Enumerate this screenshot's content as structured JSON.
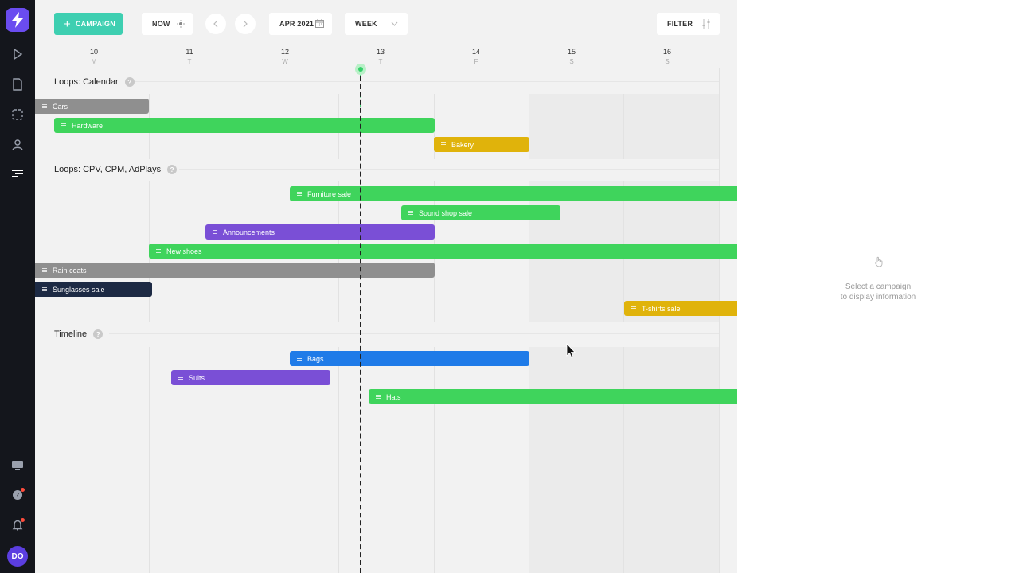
{
  "toolbar": {
    "campaign_label": "CAMPAIGN",
    "now_label": "NOW",
    "date_label": "APR 2021",
    "view_label": "WEEK",
    "filter_label": "FILTER"
  },
  "days": [
    {
      "num": "10",
      "dow": "M"
    },
    {
      "num": "11",
      "dow": "T"
    },
    {
      "num": "12",
      "dow": "W"
    },
    {
      "num": "13",
      "dow": "T"
    },
    {
      "num": "14",
      "dow": "F"
    },
    {
      "num": "15",
      "dow": "S"
    },
    {
      "num": "16",
      "dow": "S"
    }
  ],
  "sections": [
    {
      "title": "Loops: Calendar",
      "campaigns": [
        {
          "label": "Cars",
          "color": "#8f8f8f"
        },
        {
          "label": "Hardware",
          "color": "#3fd45c"
        },
        {
          "label": "Bakery",
          "color": "#e0b30b"
        }
      ]
    },
    {
      "title": "Loops: CPV, CPM, AdPlays",
      "campaigns": [
        {
          "label": "Furniture sale",
          "color": "#3fd45c"
        },
        {
          "label": "Sound shop sale",
          "color": "#3fd45c"
        },
        {
          "label": "Announcements",
          "color": "#7a4fd6"
        },
        {
          "label": "New shoes",
          "color": "#3fd45c"
        },
        {
          "label": "Rain coats",
          "color": "#8f8f8f"
        },
        {
          "label": "Sunglasses sale",
          "color": "#1d2a44"
        },
        {
          "label": "T-shirts sale",
          "color": "#e0b30b"
        }
      ]
    },
    {
      "title": "Timeline",
      "campaigns": [
        {
          "label": "Bags",
          "color": "#1f7be8"
        },
        {
          "label": "Suits",
          "color": "#7a4fd6"
        },
        {
          "label": "Hats",
          "color": "#3fd45c"
        }
      ]
    }
  ],
  "help_glyph": "?",
  "info_panel": {
    "line1": "Select a campaign",
    "line2": "to display information"
  },
  "user": {
    "initials": "DO"
  }
}
